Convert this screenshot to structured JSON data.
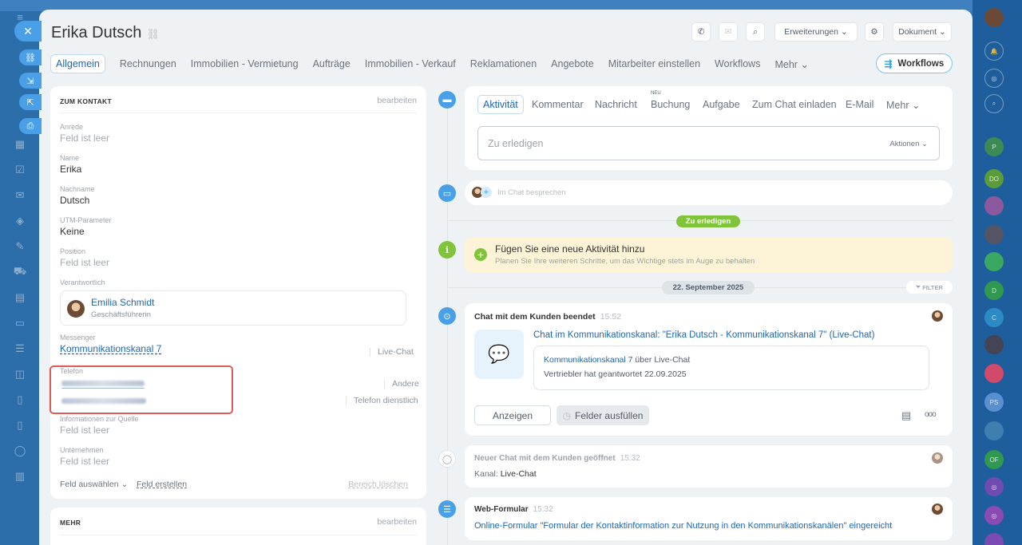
{
  "header": {
    "title": "Erika Dutsch",
    "btn_extensions": "Erweiterungen",
    "btn_document": "Dokument"
  },
  "tabs": [
    "Allgemein",
    "Rechnungen",
    "Immobilien - Vermietung",
    "Aufträge",
    "Immobilien - Verkauf",
    "Reklamationen",
    "Angebote",
    "Mitarbeiter einstellen",
    "Workflows",
    "Mehr"
  ],
  "workflows_button": "Workflows",
  "contact_card": {
    "heading": "ZUM KONTAKT",
    "edit": "bearbeiten",
    "fields": {
      "salutation_label": "Anrede",
      "salutation_value": "Feld ist leer",
      "name_label": "Name",
      "name_value": "Erika",
      "lastname_label": "Nachname",
      "lastname_value": "Dutsch",
      "utm_label": "UTM-Parameter",
      "utm_value": "Keine",
      "position_label": "Position",
      "position_value": "Feld ist leer",
      "responsible_label": "Verantwortlich",
      "messenger_label": "Messenger",
      "messenger_value": "Kommunikationskanal 7",
      "messenger_type": "Live-Chat",
      "phone_label": "Telefon",
      "phone_type_1": "Andere",
      "phone_type_2": "Telefon dienstlich",
      "source_label": "Informationen zur Quelle",
      "source_value": "Feld ist leer",
      "company_label": "Unternehmen",
      "company_value": "Feld ist leer"
    },
    "responsible": {
      "name": "Emilia Schmidt",
      "role": "Geschäftsführerin"
    },
    "select_field": "Feld auswählen",
    "create_field": "Feld erstellen",
    "delete_section": "Bereich löschen"
  },
  "more_card": {
    "heading": "MEHR",
    "edit": "bearbeiten"
  },
  "activity": {
    "tabs": [
      "Aktivität",
      "Kommentar",
      "Nachricht",
      "Buchung",
      "Aufgabe",
      "Zum Chat einladen",
      "E-Mail",
      "Mehr"
    ],
    "new_badge": "NEU",
    "todo_placeholder": "Zu erledigen",
    "actions": "Aktionen",
    "chat_placeholder": "Im Chat besprechen"
  },
  "timeline": {
    "todo_pill": "Zu erledigen",
    "hint_title": "Fügen Sie eine neue Aktivität hinzu",
    "hint_sub": "Planen Sie Ihre weiteren Schritte, um das Wichtige stets im Auge zu behalten",
    "date_pill": "22. September 2025",
    "filter": "FILTER",
    "item1": {
      "title": "Chat mit dem Kunden beendet",
      "time": "15:52",
      "link": "Chat im Kommunikationskanal: \"Erika Dutsch - Kommunikationskanal 7\" (Live-Chat)",
      "channel_link": "Kommunikationskanal 7",
      "channel_suffix": "über Live-Chat",
      "answered": "Vertriebler hat geantwortet 22.09.2025",
      "btn_show": "Anzeigen",
      "btn_fill": "Felder ausfüllen",
      "more": "ooo"
    },
    "item2": {
      "title": "Neuer Chat mit dem Kunden geöffnet",
      "time": "15:32",
      "channel_label": "Kanal:",
      "channel_value": "Live-Chat"
    },
    "item3": {
      "title": "Web-Formular",
      "time": "15:32",
      "link": "Online-Formular \"Formular der Kontaktinformation zur Nutzung in den Kommunikationskanälen\" eingereicht"
    }
  },
  "colors": {
    "accent": "#2067b0",
    "green": "#7fc43a",
    "highlight": "#e05a5a",
    "hint_bg": "#fdf4d8"
  }
}
